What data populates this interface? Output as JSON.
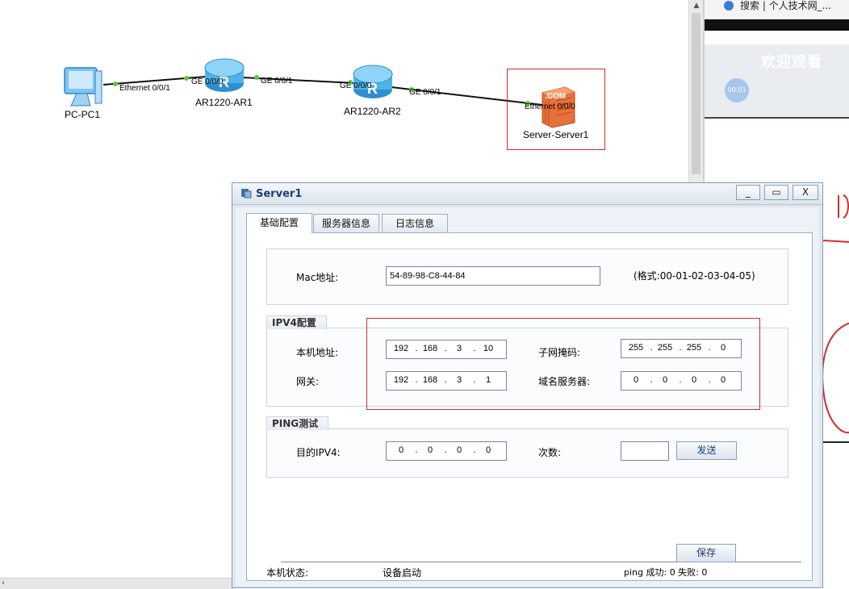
{
  "topology": {
    "devices": [
      {
        "id": "pc",
        "label": "PC-PC1",
        "icon": "pc-monitor-icon"
      },
      {
        "id": "ar1",
        "label": "AR1220-AR1",
        "icon": "router-icon"
      },
      {
        "id": "ar2",
        "label": "AR1220-AR2",
        "icon": "router-icon"
      },
      {
        "id": "server",
        "label": "Server-Server1",
        "icon": "server-icon",
        "badge": ".COM"
      }
    ],
    "ports": {
      "pc_port": "Ethernet 0/0/1",
      "ar1_left": "GE 0/0/0",
      "ar1_right": "GE 0/0/1",
      "ar2_left": "GE 0/0/0",
      "ar2_right": "GE 0/0/1",
      "server_port": "Ethernet 0/0/0"
    },
    "link_dot_color": "#5cc93b"
  },
  "browser": {
    "tab_title": "搜索 | 个人技术网_...",
    "video_title": "欢迎观看",
    "video_time": "00:01"
  },
  "dialog": {
    "title": "Server1",
    "window_buttons": {
      "minimize": "_",
      "maximize": "▭",
      "close": "X"
    },
    "tabs": [
      {
        "label": "基础配置",
        "active": true
      },
      {
        "label": "服务器信息",
        "active": false
      },
      {
        "label": "日志信息",
        "active": false
      }
    ],
    "mac": {
      "label": "Mac地址:",
      "value": "54-89-98-C8-44-84",
      "hint": "(格式:00-01-02-03-04-05)"
    },
    "ipv4": {
      "legend": "IPV4配置",
      "local_label": "本机地址:",
      "local_ip": [
        "192",
        "168",
        "3",
        "10"
      ],
      "mask_label": "子网掩码:",
      "mask": [
        "255",
        "255",
        "255",
        "0"
      ],
      "gateway_label": "网关:",
      "gateway": [
        "192",
        "168",
        "3",
        "1"
      ],
      "dns_label": "域名服务器:",
      "dns": [
        "0",
        "0",
        "0",
        "0"
      ]
    },
    "ping": {
      "legend": "PING测试",
      "dest_label": "目的IPV4:",
      "dest": [
        "0",
        "0",
        "0",
        "0"
      ],
      "count_label": "次数:",
      "count_value": "",
      "send_label": "发送"
    },
    "status": {
      "label": "本机状态:",
      "value": "设备启动",
      "ping_result": "ping 成功: 0 失败: 0"
    },
    "save_label": "保存"
  },
  "colors": {
    "highlight": "#d42b2b",
    "dialog_title": "#1d3f70",
    "router_blue": "#3fa7e0",
    "server_orange": "#e8703a"
  }
}
